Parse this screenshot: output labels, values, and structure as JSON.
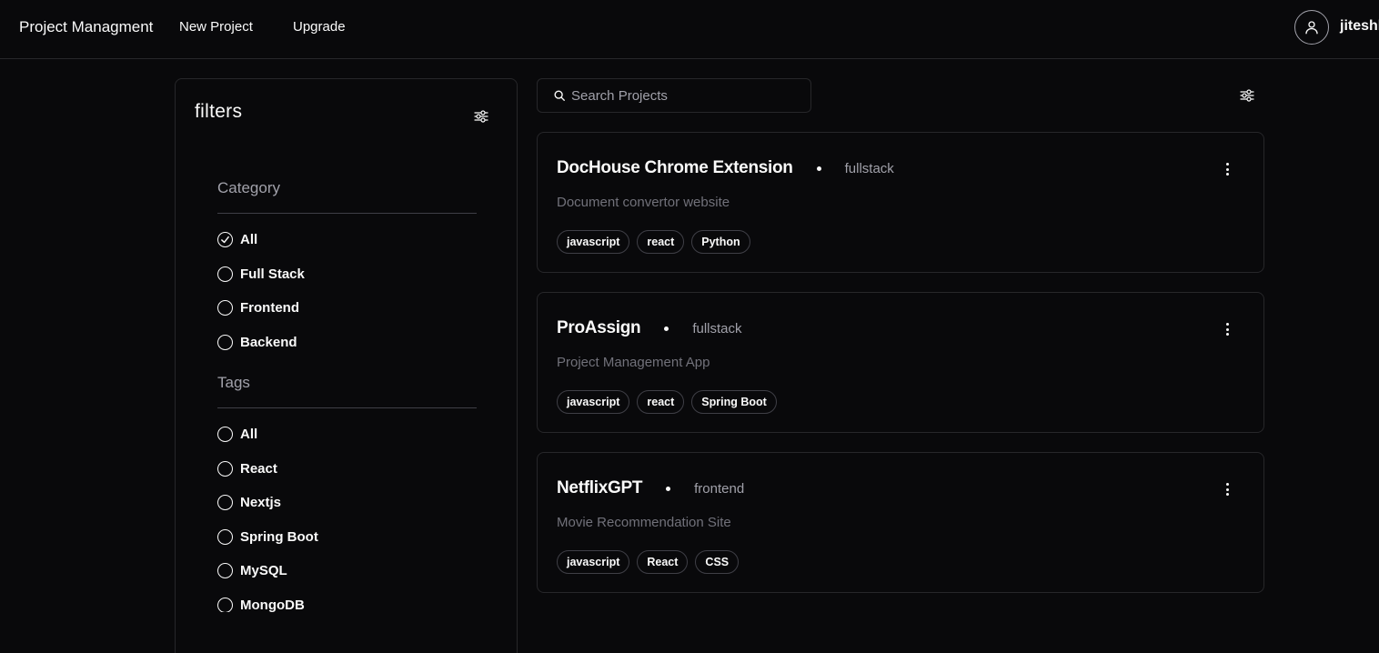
{
  "navbar": {
    "brand": "Project Managment",
    "links": [
      "New Project",
      "Upgrade"
    ],
    "username": "jiteshkum"
  },
  "filters": {
    "title": "filters",
    "category": {
      "heading": "Category",
      "options": [
        "All",
        "Full Stack",
        "Frontend",
        "Backend"
      ],
      "selected": "All"
    },
    "tags": {
      "heading": "Tags",
      "options": [
        "All",
        "React",
        "Nextjs",
        "Spring Boot",
        "MySQL",
        "MongoDB"
      ]
    }
  },
  "search": {
    "placeholder": "Search Projects",
    "value": ""
  },
  "projects": [
    {
      "name": "DocHouse Chrome Extension",
      "category": "fullstack",
      "description": "Document convertor website",
      "tags": [
        "javascript",
        "react",
        "Python"
      ]
    },
    {
      "name": "ProAssign",
      "category": "fullstack",
      "description": "Project Management App",
      "tags": [
        "javascript",
        "react",
        "Spring Boot"
      ]
    },
    {
      "name": "NetflixGPT",
      "category": "frontend",
      "description": "Movie Recommendation Site",
      "tags": [
        "javascript",
        "React",
        "CSS"
      ]
    }
  ],
  "icons": {
    "filter": "sliders-icon",
    "search": "search-icon",
    "avatar": "user-icon",
    "more": "more-vertical-icon",
    "checked": "check-circle-icon",
    "unchecked": "circle-icon"
  }
}
